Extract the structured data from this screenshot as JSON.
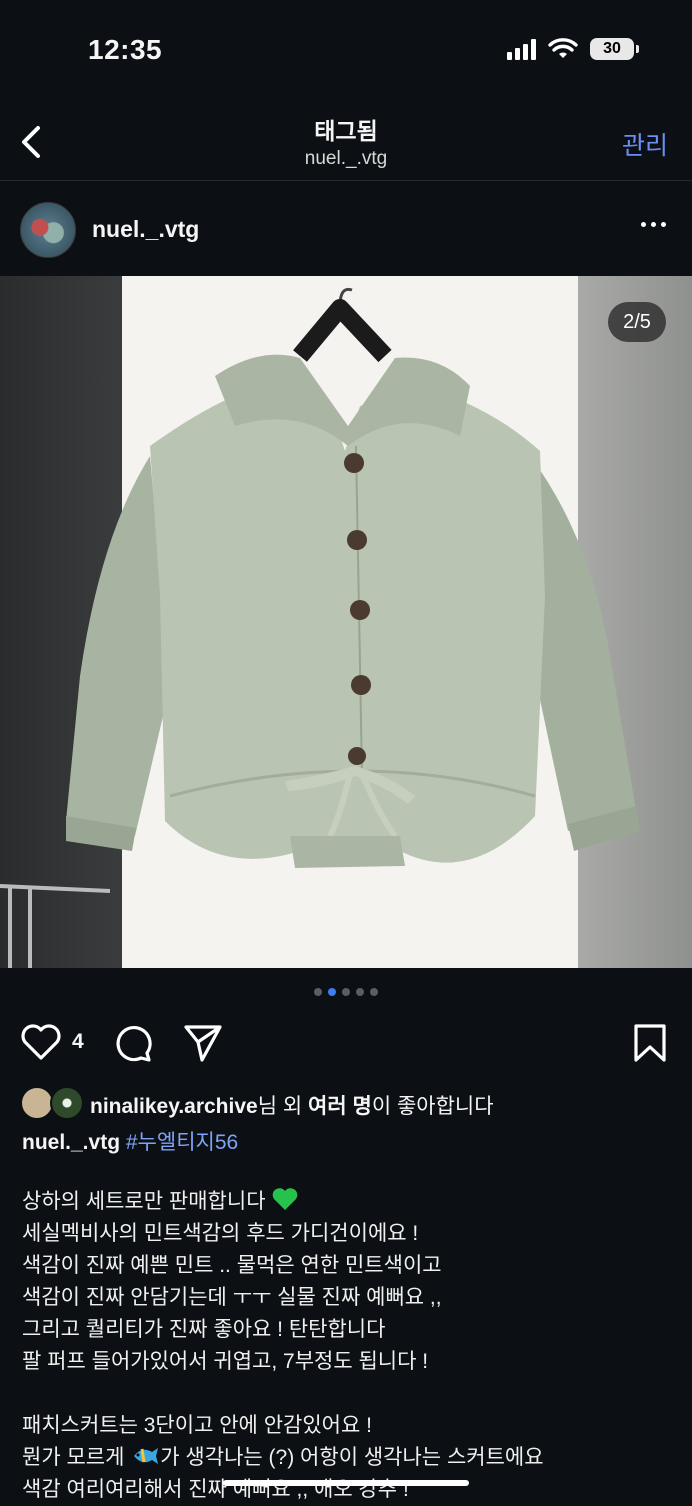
{
  "status_bar": {
    "time": "12:35",
    "battery": "30"
  },
  "nav": {
    "title": "태그됨",
    "subtitle": "nuel._.vtg",
    "manage": "관리"
  },
  "post": {
    "username": "nuel._.vtg",
    "counter": "2/5",
    "image_index": 2,
    "image_total": 5,
    "likes": "4",
    "liked_by": {
      "user": "ninalikey.archive",
      "suffix_1": "님 외 ",
      "others": "여러 명",
      "suffix_2": "이 좋아합니다"
    },
    "caption_user": "nuel._.vtg",
    "caption_tag": "#누엘티지56",
    "caption_lines": [
      "상하의 세트로만 판매합니다",
      "세실멕비사의 민트색감의 후드 가디건이에요 !",
      "색감이 진짜 예쁜 민트 .. 물먹은 연한 민트색이고",
      "색감이 진짜 안담기는데 ㅜㅜ 실물 진짜 예뻐요 ,,",
      "그리고 퀄리티가 진짜 좋아요 ! 탄탄합니다",
      "팔 퍼프 들어가있어서 귀엽고, 7부정도 됩니다 !",
      "",
      "패치스커트는 3단이고 안에 안감있어요 !",
      "뭔가 모르게",
      "가 생각나는 (?) 어항이 생각나는 스커트에요",
      "색감 여리여리해서 진짜 예뻐요 ,, 애오 강추 !"
    ]
  },
  "colors": {
    "background": "#0c1014",
    "accent": "#3d7cf2",
    "tag": "#7ea4f5",
    "manage": "#6b8ff5",
    "jacket": "#b9c4b2"
  }
}
